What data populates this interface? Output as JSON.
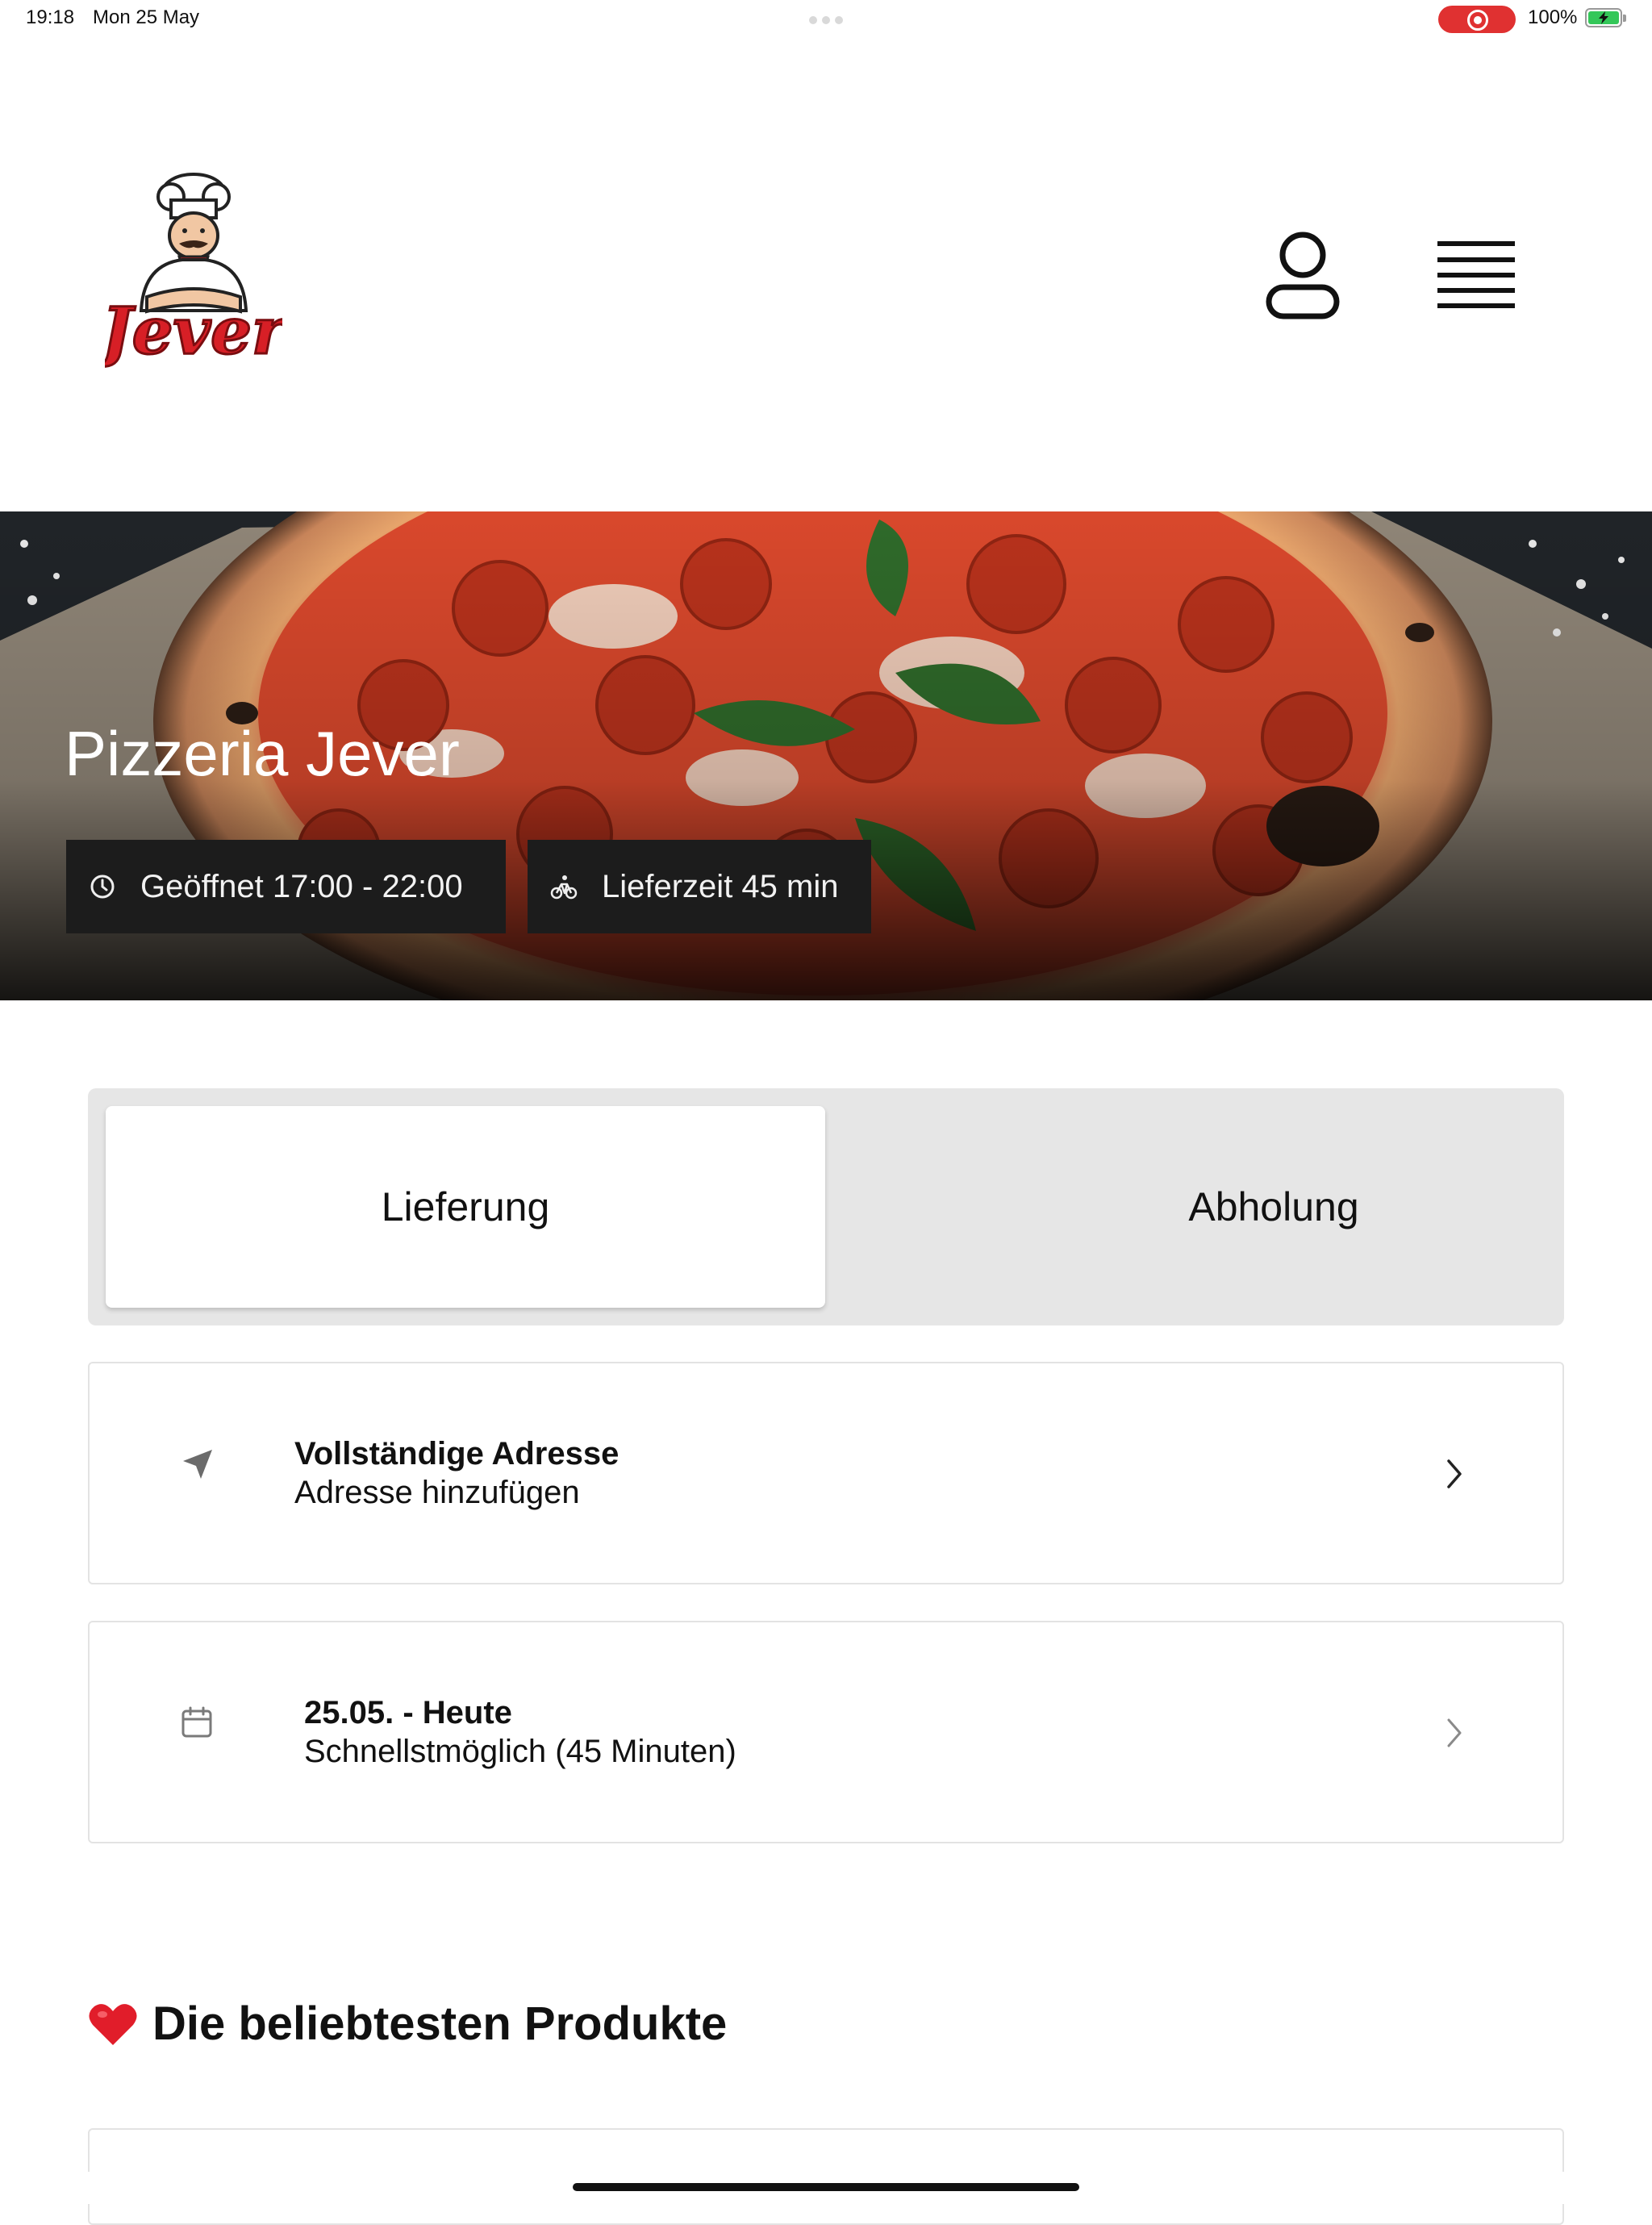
{
  "status_bar": {
    "time": "19:18",
    "date": "Mon 25 May",
    "battery_percent": "100%",
    "recording": true
  },
  "header": {
    "logo_text": "Jever",
    "profile_icon": "person-icon",
    "menu_icon": "hamburger-menu-icon"
  },
  "hero": {
    "title": "Pizzeria Jever",
    "opening_hours": "Geöffnet 17:00 - 22:00",
    "delivery_time": "Lieferzeit 45 min",
    "opening_icon": "clock-icon",
    "delivery_icon": "bicycle-icon"
  },
  "order_mode": {
    "options": [
      "Lieferung",
      "Abholung"
    ],
    "selected": "Lieferung"
  },
  "address_card": {
    "title": "Vollständige Adresse",
    "subtitle": "Adresse hinzufügen",
    "icon": "location-arrow-icon"
  },
  "time_card": {
    "title": "25.05. - Heute",
    "subtitle": "Schnellstmöglich (45 Minuten)",
    "icon": "calendar-icon"
  },
  "popular": {
    "title": "Die beliebtesten Produkte",
    "icon": "heart-icon"
  },
  "colors": {
    "brand_red": "#d71f26",
    "chip_bg": "#1c1c1c",
    "segment_bg": "#e6e6e6"
  }
}
